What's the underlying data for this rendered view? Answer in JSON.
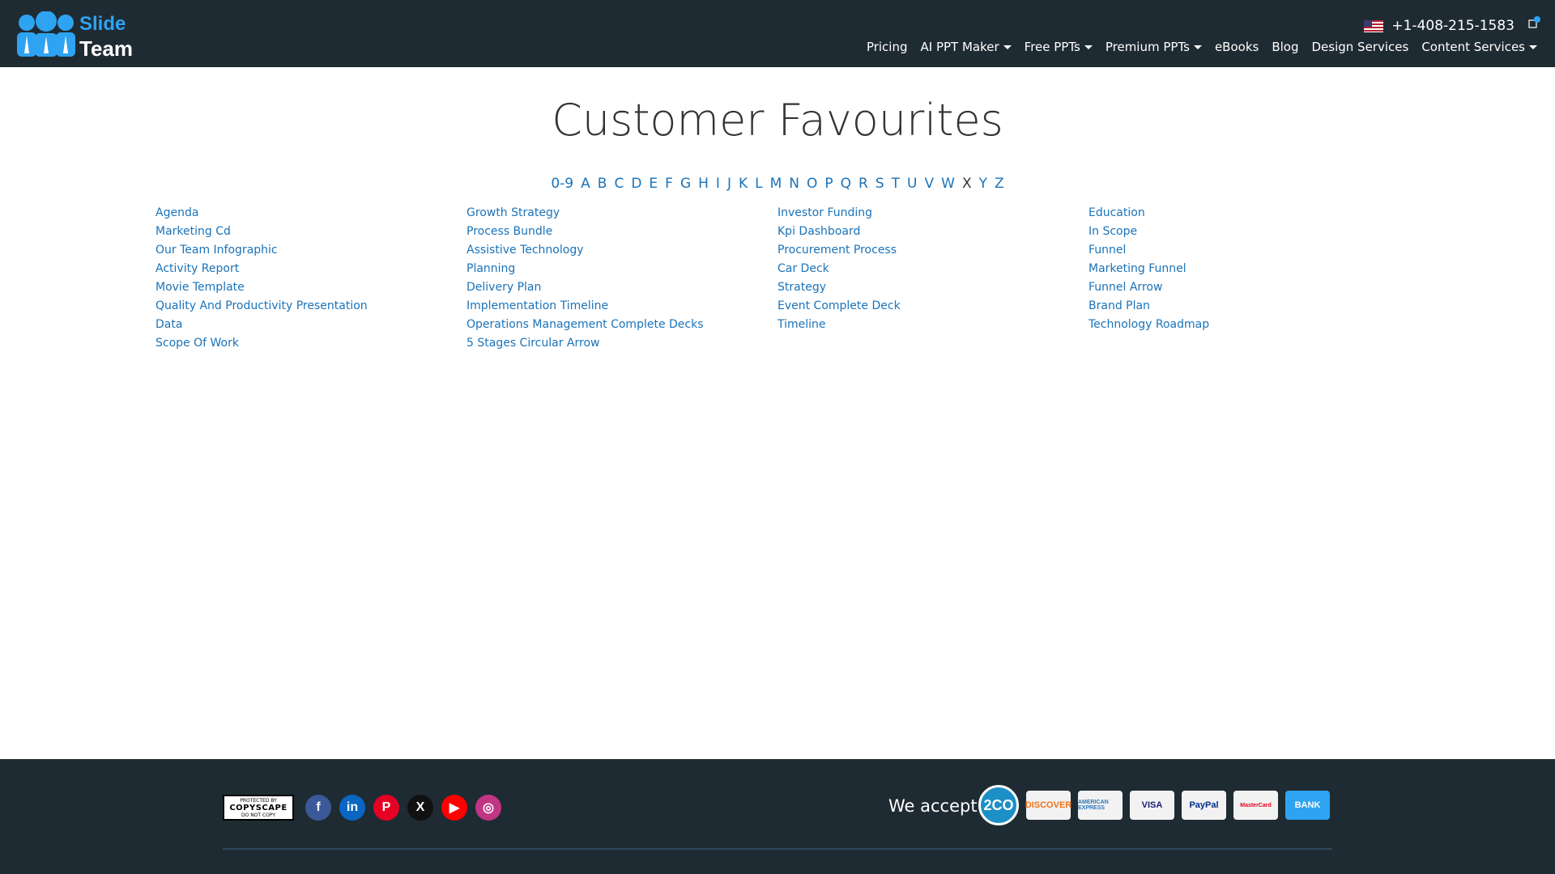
{
  "header": {
    "logo_line1": "Slide",
    "logo_line2": "Team",
    "phone": "+1-408-215-1583",
    "nav": [
      {
        "label": "Pricing",
        "dropdown": false
      },
      {
        "label": "AI PPT Maker",
        "dropdown": true
      },
      {
        "label": "Free PPTs",
        "dropdown": true
      },
      {
        "label": "Premium PPTs",
        "dropdown": true
      },
      {
        "label": "eBooks",
        "dropdown": false
      },
      {
        "label": "Blog",
        "dropdown": false
      },
      {
        "label": "Design Services",
        "dropdown": false
      },
      {
        "label": "Content Services",
        "dropdown": true
      }
    ]
  },
  "main": {
    "title": "Customer Favourites",
    "alphabet": [
      "0-9",
      "A",
      "B",
      "C",
      "D",
      "E",
      "F",
      "G",
      "H",
      "I",
      "J",
      "K",
      "L",
      "M",
      "N",
      "O",
      "P",
      "Q",
      "R",
      "S",
      "T",
      "U",
      "V",
      "W",
      "X",
      "Y",
      "Z"
    ],
    "alphabet_inactive": [
      "X"
    ],
    "columns": [
      [
        "Agenda",
        "Marketing Cd",
        "Our Team Infographic",
        "Activity Report",
        "Movie Template",
        "Quality And Productivity Presentation",
        "Data",
        "Scope Of Work"
      ],
      [
        "Growth Strategy",
        "Process Bundle",
        "Assistive Technology",
        "Planning",
        "Delivery Plan",
        "Implementation Timeline",
        "Operations Management Complete Decks",
        "5 Stages Circular Arrow"
      ],
      [
        "Investor Funding",
        "Kpi Dashboard",
        "Procurement Process",
        "Car Deck",
        "Strategy",
        "Event Complete Deck",
        "Timeline"
      ],
      [
        "Education",
        "In Scope",
        "Funnel",
        "Marketing Funnel",
        "Funnel Arrow",
        "Brand Plan",
        "Technology Roadmap"
      ]
    ]
  },
  "footer": {
    "copyscape": {
      "line1": "PROTECTED BY",
      "line2": "COPYSCAPE",
      "line3": "DO NOT COPY"
    },
    "socials": [
      {
        "name": "facebook-icon",
        "glyph": "f",
        "color": "#3b5998"
      },
      {
        "name": "linkedin-icon",
        "glyph": "in",
        "color": "#0a66c2"
      },
      {
        "name": "pinterest-icon",
        "glyph": "P",
        "color": "#e60023"
      },
      {
        "name": "x-icon",
        "glyph": "X",
        "color": "#111111"
      },
      {
        "name": "youtube-icon",
        "glyph": "▶",
        "color": "#ff0000"
      },
      {
        "name": "instagram-icon",
        "glyph": "◎",
        "color": "#c13584"
      }
    ],
    "accept_label": "We accept:",
    "payments": [
      {
        "name": "2co-icon",
        "label": "2CO",
        "color": "#1c8fc6"
      },
      {
        "name": "discover-icon",
        "label": "DISCOVER",
        "color": "#f47216"
      },
      {
        "name": "amex-icon",
        "label": "AMERICAN EXPRESS",
        "color": "#2e77bb"
      },
      {
        "name": "visa-icon",
        "label": "VISA",
        "color": "#1a1f71"
      },
      {
        "name": "paypal-icon",
        "label": "PayPal",
        "color": "#003087"
      },
      {
        "name": "mastercard-icon",
        "label": "MasterCard",
        "color": "#eb001b"
      },
      {
        "name": "bank-icon",
        "label": "BANK",
        "color": "#2ea3f2"
      }
    ]
  }
}
